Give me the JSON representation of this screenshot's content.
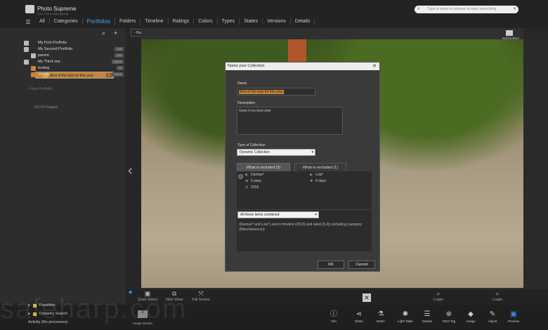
{
  "app": {
    "name": "Photo Supreme",
    "sub": "V3.0 / 3.0.3.1234 (64 bit)"
  },
  "search": {
    "placeholder": "Type a word or phrase to start searching"
  },
  "nav": {
    "menu_icon": "hamburger-icon",
    "items": [
      "All",
      "Categories",
      "Portfolios",
      "Folders",
      "Timeline",
      "Ratings",
      "Colors",
      "Types",
      "States",
      "Versions",
      "Details"
    ],
    "active": "Portfolios"
  },
  "tree": [
    {
      "label": "My First Portfolio",
      "count": ""
    },
    {
      "label": "My Second Portfolio",
      "count": "155"
    },
    {
      "label": "parent",
      "count": "200"
    },
    {
      "label": "My Third one",
      "count": "14025"
    },
    {
      "label": "testing",
      "count": "15"
    },
    {
      "label": "Best of the kids for this year",
      "count": "0"
    },
    {
      "label": "not city",
      "count": "14025"
    }
  ],
  "new_portfolio": "+ New Portfolio...",
  "image_count": "18143 images",
  "back_label": "Back",
  "exif_label": "ExifToolGUI",
  "bottom_tools": [
    {
      "icon": "photos-icon",
      "label": "Quick Select"
    },
    {
      "icon": "slideshow-icon",
      "label": "Slide Show"
    },
    {
      "icon": "fullscreen-icon",
      "label": "Full Screen"
    },
    {
      "icon": "loupe-icon",
      "label": "Loupe"
    },
    {
      "icon": "loupe-icon",
      "label": "Loupe"
    }
  ],
  "footer_panels": [
    {
      "label": "Favorites"
    },
    {
      "label": "Dynamic Search"
    },
    {
      "label": "Activity (No processes)"
    }
  ],
  "basket": {
    "count": "3",
    "label": "Image Basket"
  },
  "footer_tools": [
    "Info",
    "Share",
    "Batch",
    "Light Table",
    "Details",
    "GEO Tag",
    "Assign",
    "Adjust",
    "Preview"
  ],
  "watermark": "safeharp.com",
  "dialog": {
    "title": "Name your Collection",
    "name_label": "Name",
    "name_value": "Best of the kids for this year",
    "desc_label": "Description",
    "desc_value": "Gave it my best shot",
    "type_label": "Type of Collection",
    "type_value": "Dynamic Collection",
    "tab_included": "What is included (3)",
    "tab_excluded": "What is excluded (1)",
    "criteria_left": [
      "Damian*",
      "5 stars",
      "2018"
    ],
    "criteria_right": [
      "Lola*",
      "4 stars"
    ],
    "combine_value": "All these items combined",
    "explanation": "(Damian* and Lola*) and in timeline (2018) and rated (5,4)) excluding (category (Miscellaneous))",
    "ok_label": "OK",
    "cancel_label": "Cancel"
  }
}
